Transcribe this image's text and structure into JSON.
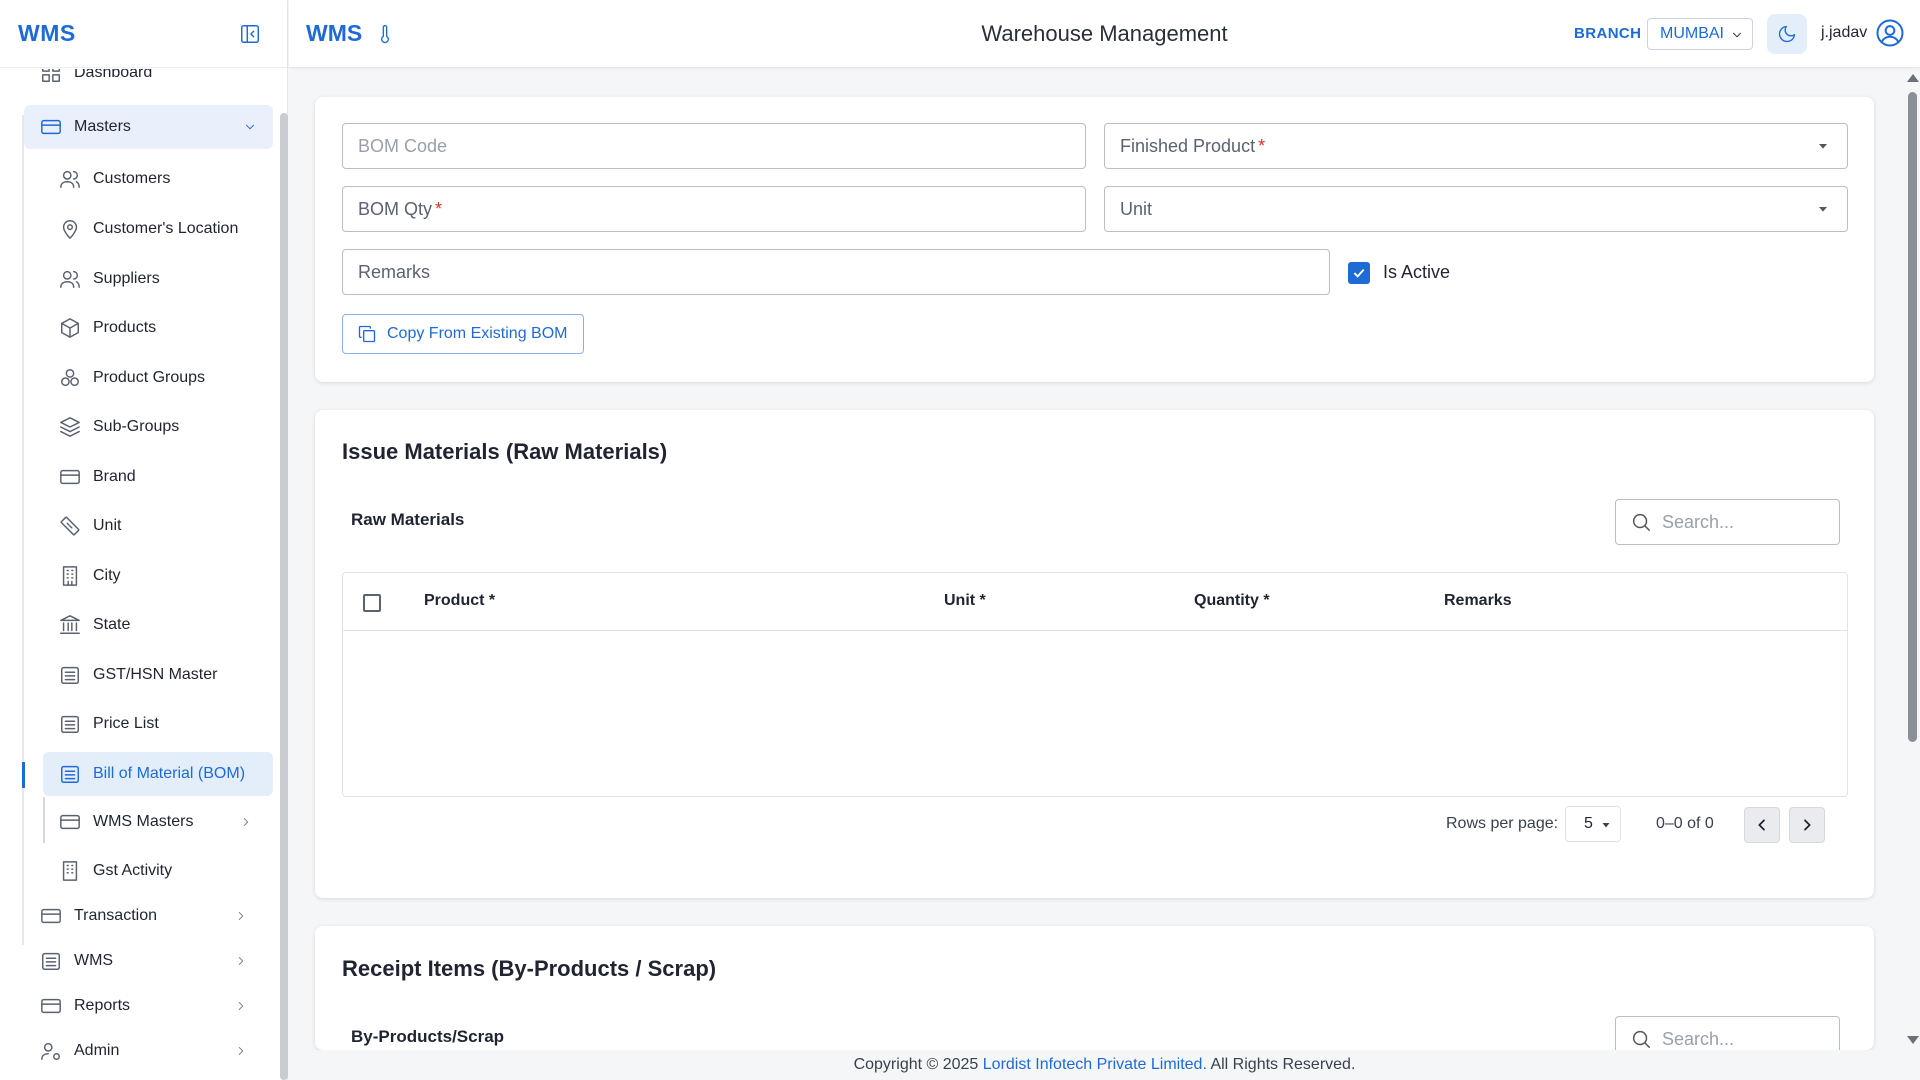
{
  "sidebar": {
    "logo": "WMS",
    "items": {
      "dashboard": "Dashboard",
      "masters": "Masters",
      "customers": "Customers",
      "customers_location": "Customer's Location",
      "suppliers": "Suppliers",
      "products": "Products",
      "product_groups": "Product Groups",
      "sub_groups": "Sub-Groups",
      "brand": "Brand",
      "unit": "Unit",
      "city": "City",
      "state": "State",
      "gst_hsn": "GST/HSN Master",
      "price_list": "Price List",
      "bom": "Bill of Material (BOM)",
      "wms_masters": "WMS Masters",
      "gst_activity": "Gst Activity",
      "transaction": "Transaction",
      "wms": "WMS",
      "reports": "Reports",
      "admin": "Admin"
    }
  },
  "header": {
    "logo": "WMS",
    "title": "Warehouse Management",
    "branch_label": "BRANCH",
    "branch_value": "MUMBAI",
    "user": "j.jadav"
  },
  "form": {
    "bom_code_placeholder": "BOM Code",
    "finished_product_label": "Finished Product",
    "bom_qty_label": "BOM Qty",
    "unit_label": "Unit",
    "remarks_label": "Remarks",
    "is_active_label": "Is Active",
    "is_active": true,
    "copy_button": "Copy From Existing BOM",
    "required_mark": "*"
  },
  "issue_section": {
    "title": "Issue Materials (Raw Materials)",
    "subtitle": "Raw Materials",
    "search_placeholder": "Search...",
    "columns": [
      "Product *",
      "Unit *",
      "Quantity *",
      "Remarks"
    ],
    "rows": [],
    "rows_per_page_label": "Rows per page:",
    "rows_per_page": "5",
    "range": "0–0 of 0"
  },
  "receipt_section": {
    "title": "Receipt Items (By-Products / Scrap)",
    "subtitle": "By-Products/Scrap",
    "search_placeholder": "Search..."
  },
  "footer": {
    "prefix": "Copyright © 2025 ",
    "company": "Lordist Infotech Private Limited.",
    "suffix": " All Rights Reserved."
  },
  "colors": {
    "accent": "#1e6bd6",
    "required": "#d93025",
    "active_bg": "#e4edfa"
  }
}
